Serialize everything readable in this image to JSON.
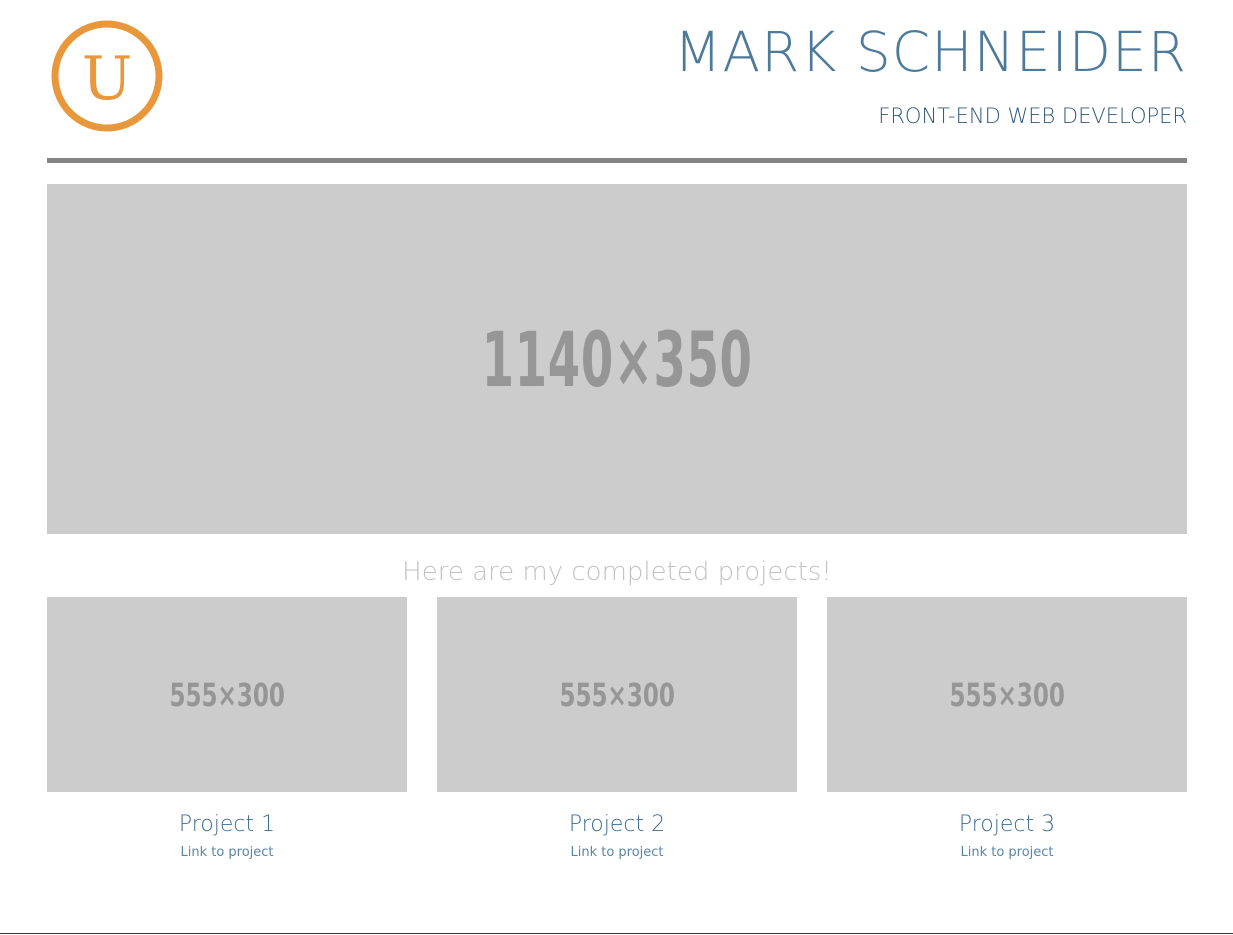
{
  "header": {
    "logo_letter": "U",
    "name": "MARK SCHNEIDER",
    "role": "FRONT-END WEB DEVELOPER"
  },
  "hero": {
    "placeholder_label": "1140×350"
  },
  "tagline": "Here are my completed projects!",
  "projects": [
    {
      "thumb_label": "555×300",
      "title": "Project 1",
      "link": "Link to project"
    },
    {
      "thumb_label": "555×300",
      "title": "Project 2",
      "link": "Link to project"
    },
    {
      "thumb_label": "555×300",
      "title": "Project 3",
      "link": "Link to project"
    }
  ],
  "colors": {
    "logo_orange": "#e8973a",
    "heading_blue": "#4e7a99",
    "rule_gray": "#858383",
    "placeholder_gray": "#cccccc"
  }
}
